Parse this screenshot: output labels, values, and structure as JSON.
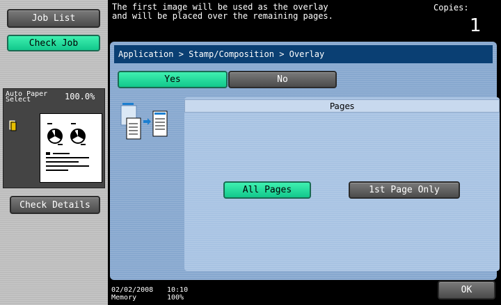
{
  "sidebar": {
    "job_list": "Job List",
    "check_job": "Check Job",
    "paper_label_1": "Auto Paper",
    "paper_label_2": "Select",
    "zoom": "100.0%",
    "check_details": "Check Details"
  },
  "header": {
    "message": "The first image will be used as the overlay\nand will be placed over the remaining pages.",
    "copies_label": "Copies:",
    "copies_value": "1"
  },
  "breadcrumb": "Application > Stamp/Composition > Overlay",
  "toggle": {
    "yes": "Yes",
    "no": "No",
    "selected": "Yes"
  },
  "pages": {
    "title": "Pages",
    "all_pages": "All Pages",
    "first_page_only": "1st Page Only",
    "selected": "All Pages"
  },
  "footer": {
    "date": "02/02/2008",
    "time": "10:10",
    "memory_label": "Memory",
    "memory_value": "100%",
    "ok": "OK"
  }
}
